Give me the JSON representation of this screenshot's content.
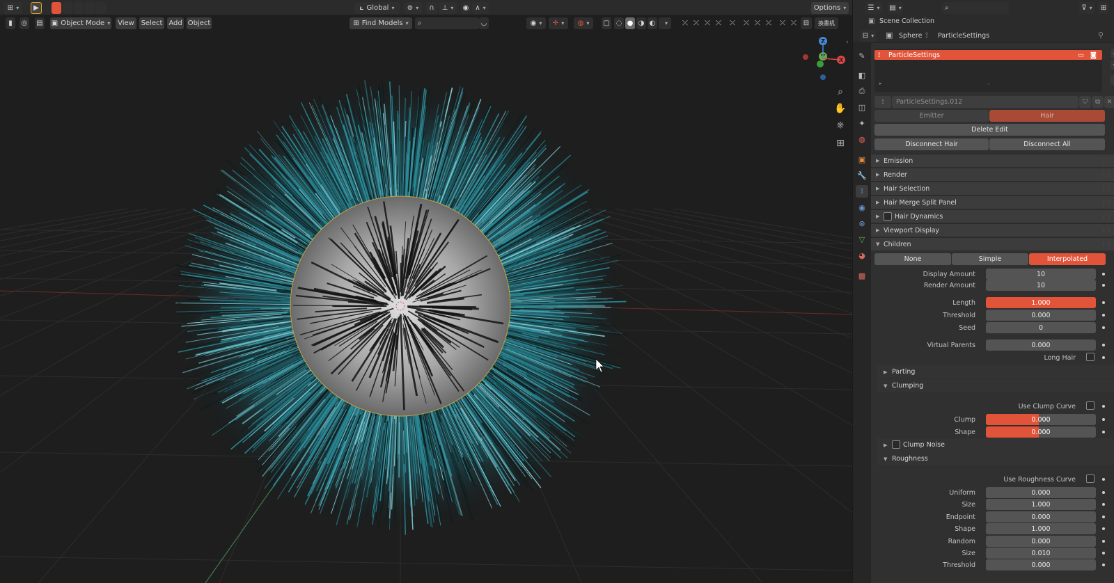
{
  "viewport": {
    "transform_orientation": "Global",
    "options_label": "Options",
    "mode": "Object Mode",
    "menus": [
      "View",
      "Select",
      "Add",
      "Object"
    ],
    "find_models": "Find Models",
    "ime_label": "換書机",
    "gizmo": {
      "z": "Z",
      "y": "Y",
      "x": "X"
    }
  },
  "properties": {
    "scene_collection": "Scene Collection",
    "breadcrumb": {
      "object": "Sphere",
      "settings": "ParticleSettings"
    },
    "particle_system": "ParticleSettings",
    "datablock": "ParticleSettings.012",
    "type_emitter": "Emitter",
    "type_hair": "Hair",
    "delete_edit": "Delete Edit",
    "disconnect_hair": "Disconnect Hair",
    "disconnect_all": "Disconnect All",
    "panels": [
      "Emission",
      "Render",
      "Hair Selection",
      "Hair Merge Split Panel",
      "Hair Dynamics",
      "Viewport Display",
      "Children"
    ],
    "children": {
      "modes": [
        "None",
        "Simple",
        "Interpolated"
      ],
      "active_mode": "Interpolated",
      "display_amount_label": "Display Amount",
      "display_amount": "10",
      "render_amount_label": "Render Amount",
      "render_amount": "10",
      "length_label": "Length",
      "length": "1.000",
      "threshold_label": "Threshold",
      "threshold": "0.000",
      "seed_label": "Seed",
      "seed": "0",
      "virtual_parents_label": "Virtual Parents",
      "virtual_parents": "0.000",
      "long_hair_label": "Long Hair",
      "parting": "Parting",
      "clumping": "Clumping",
      "use_clump_curve_label": "Use Clump Curve",
      "clump_label": "Clump",
      "clump": "0.000",
      "shape_label": "Shape",
      "shape": "0.000",
      "clump_noise": "Clump Noise",
      "roughness": "Roughness",
      "use_roughness_curve_label": "Use Roughness Curve",
      "uniform_label": "Uniform",
      "uniform": "0.000",
      "size_label": "Size",
      "size": "1.000",
      "endpoint_label": "Endpoint",
      "endpoint": "0.000",
      "end_shape_label": "Shape",
      "end_shape": "1.000",
      "random_label": "Random",
      "random": "0.000",
      "random_size_label": "Size",
      "random_size": "0.010",
      "random_threshold_label": "Threshold",
      "random_threshold": "0.000"
    }
  },
  "colors": {
    "accent": "#e2543a",
    "hair": "#2a8c9a",
    "select_blue": "#5680c2"
  }
}
